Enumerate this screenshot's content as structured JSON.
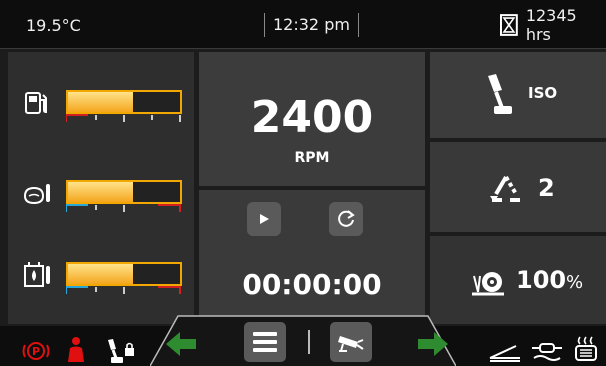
{
  "status_bar": {
    "temperature": "19.5°C",
    "time": "12:32 pm",
    "engine_hours": "12345 hrs"
  },
  "gauges": [
    {
      "name": "fuel",
      "icon": "fuel-pump-icon",
      "level": 0.58
    },
    {
      "name": "engine-oil-temperature",
      "icon": "oil-temperature-icon",
      "level": 0.58
    },
    {
      "name": "hydraulic-oil-temperature",
      "icon": "hydraulic-tank-temperature-icon",
      "level": 0.58
    }
  ],
  "rpm": {
    "value": "2400",
    "unit": "RPM"
  },
  "timer": {
    "value": "00:00:00"
  },
  "pattern": {
    "label": "ISO",
    "icon": "joystick-icon"
  },
  "gear": {
    "value": "2",
    "icon": "triangle-arrows-icon"
  },
  "speed": {
    "value": "100",
    "unit": "%",
    "icon": "snail-icon"
  },
  "colors": {
    "bar_border": "#f2a800",
    "cold_zone": "#2aa6d8",
    "hot_zone": "#d22020",
    "nav_arrow": "#2f8b2f",
    "warning": "#e01010"
  }
}
